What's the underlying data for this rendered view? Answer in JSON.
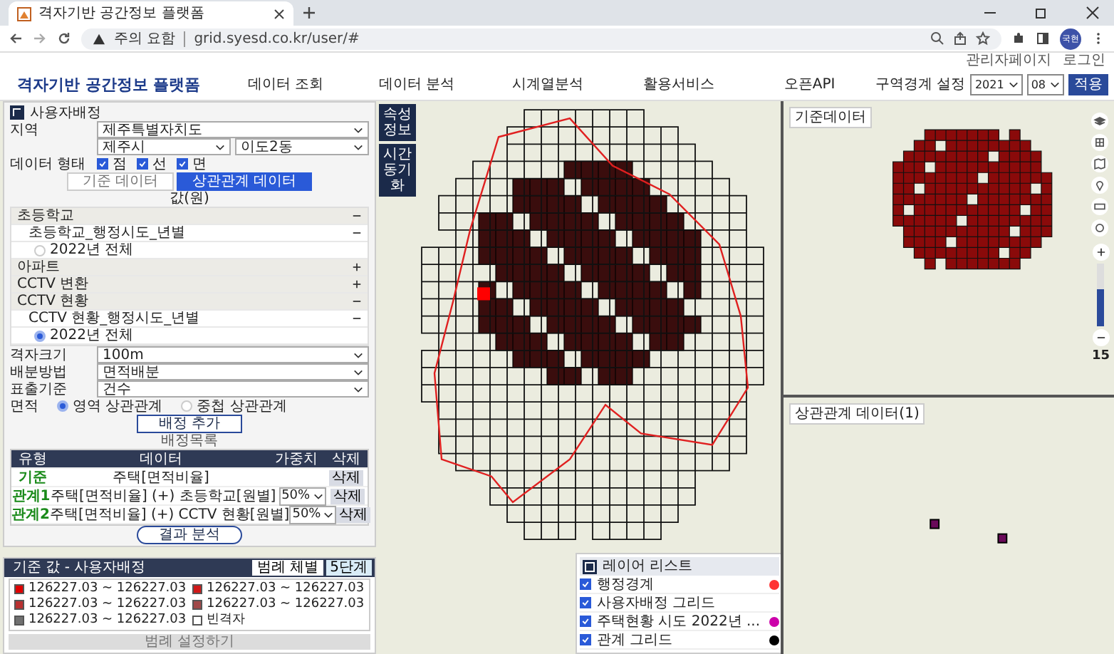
{
  "browser": {
    "tab_title": "격자기반 공간정보 플랫폼",
    "security_label": "주의 요함",
    "url": "grid.syesd.co.kr/user/#",
    "profile": "국현"
  },
  "header": {
    "util_links": [
      "관리자페이지",
      "로그인"
    ],
    "logo": "격자기반 공간정보 플랫폼",
    "nav": [
      "데이터 조회",
      "데이터 분석",
      "시계열분석",
      "활용서비스",
      "오픈API"
    ],
    "boundary_label": "구역경계 설정",
    "year": "2021",
    "month": "08",
    "apply": "적용"
  },
  "panel": {
    "title": "사용자배정",
    "region_label": "지역",
    "province": "제주특별자치도",
    "city": "제주시",
    "district": "이도2동",
    "data_type_label": "데이터 형태",
    "data_types": [
      {
        "label": "점",
        "checked": true
      },
      {
        "label": "선",
        "checked": true
      },
      {
        "label": "면",
        "checked": true
      }
    ],
    "tabs": [
      {
        "label": "기준 데이터",
        "selected": false
      },
      {
        "label": "상관관계 데이터",
        "selected": true
      }
    ],
    "value_label": "값(원)",
    "tree": [
      {
        "label": "초등학교",
        "expanded": true,
        "children": [
          {
            "label": "초등학교_행정시도_년별",
            "expanded": true,
            "children": [
              {
                "label": "2022년 전체",
                "selected": false
              }
            ]
          }
        ]
      },
      {
        "label": "아파트",
        "expanded": false
      },
      {
        "label": "CCTV 변환",
        "expanded": false
      },
      {
        "label": "CCTV 현황",
        "expanded": true,
        "children": [
          {
            "label": "CCTV 현황_행정시도_년별",
            "expanded": true,
            "children": [
              {
                "label": "2022년 전체",
                "selected": true
              }
            ]
          }
        ]
      }
    ],
    "settings": [
      {
        "label": "격자크기",
        "value": "100m"
      },
      {
        "label": "배분방법",
        "value": "면적배분"
      },
      {
        "label": "표출기준",
        "value": "건수"
      }
    ],
    "area_label": "면적",
    "area_options": [
      {
        "label": "영역 상관관계",
        "selected": true
      },
      {
        "label": "중첩 상관관계",
        "selected": false
      }
    ],
    "add_button": "배정 추가",
    "list_title": "배정목록",
    "columns": [
      "유형",
      "데이터",
      "가중치",
      "삭제"
    ],
    "rows": [
      {
        "type": "기준",
        "data": "주택[면적비율]",
        "delete": "삭제"
      },
      {
        "type": "관계1",
        "data": "주택[면적비율] (+) 초등학교[원별]",
        "weight": "50%",
        "delete": "삭제"
      },
      {
        "type": "관계2",
        "data": "주택[면적비율] (+) CCTV 현황[원별]",
        "weight": "50%",
        "delete": "삭제"
      }
    ],
    "analyze_button": "결과 분석"
  },
  "map_tools": [
    "속성 정보",
    "시간 동기화"
  ],
  "legend": {
    "title": "기준 값 - 사용자배정",
    "tabs": [
      {
        "label": "범례 체별",
        "selected": false
      },
      {
        "label": "5단계",
        "selected": true
      }
    ],
    "items": [
      {
        "label": "126227.03 ~ 126227.03",
        "color": "#e00000"
      },
      {
        "label": "126227.03 ~ 126227.03",
        "color": "#d01818"
      },
      {
        "label": "126227.03 ~ 126227.03",
        "color": "#b83030"
      },
      {
        "label": "126227.03 ~ 126227.03",
        "color": "#a04848"
      },
      {
        "label": "126227.03 ~ 126227.03",
        "color": "#707070"
      },
      {
        "label": "빈격자",
        "color": "#ffffff"
      }
    ],
    "button": "범례 설정하기"
  },
  "layers": {
    "title": "레이어 리스트",
    "items": [
      {
        "label": "행정경계",
        "checked": true,
        "color": "#ff3333"
      },
      {
        "label": "사용자배정 그리드",
        "checked": true
      },
      {
        "label": "주택현황 시도 2022년 ...",
        "checked": true,
        "color": "#cc00aa"
      },
      {
        "label": "관계 그리드",
        "checked": true,
        "color": "#000000"
      }
    ]
  },
  "right": {
    "top_label": "기준데이터",
    "bottom_label": "상관관계 데이터(1)",
    "zoom_slider": {
      "level": 0.6
    },
    "zoom_level": "15"
  }
}
